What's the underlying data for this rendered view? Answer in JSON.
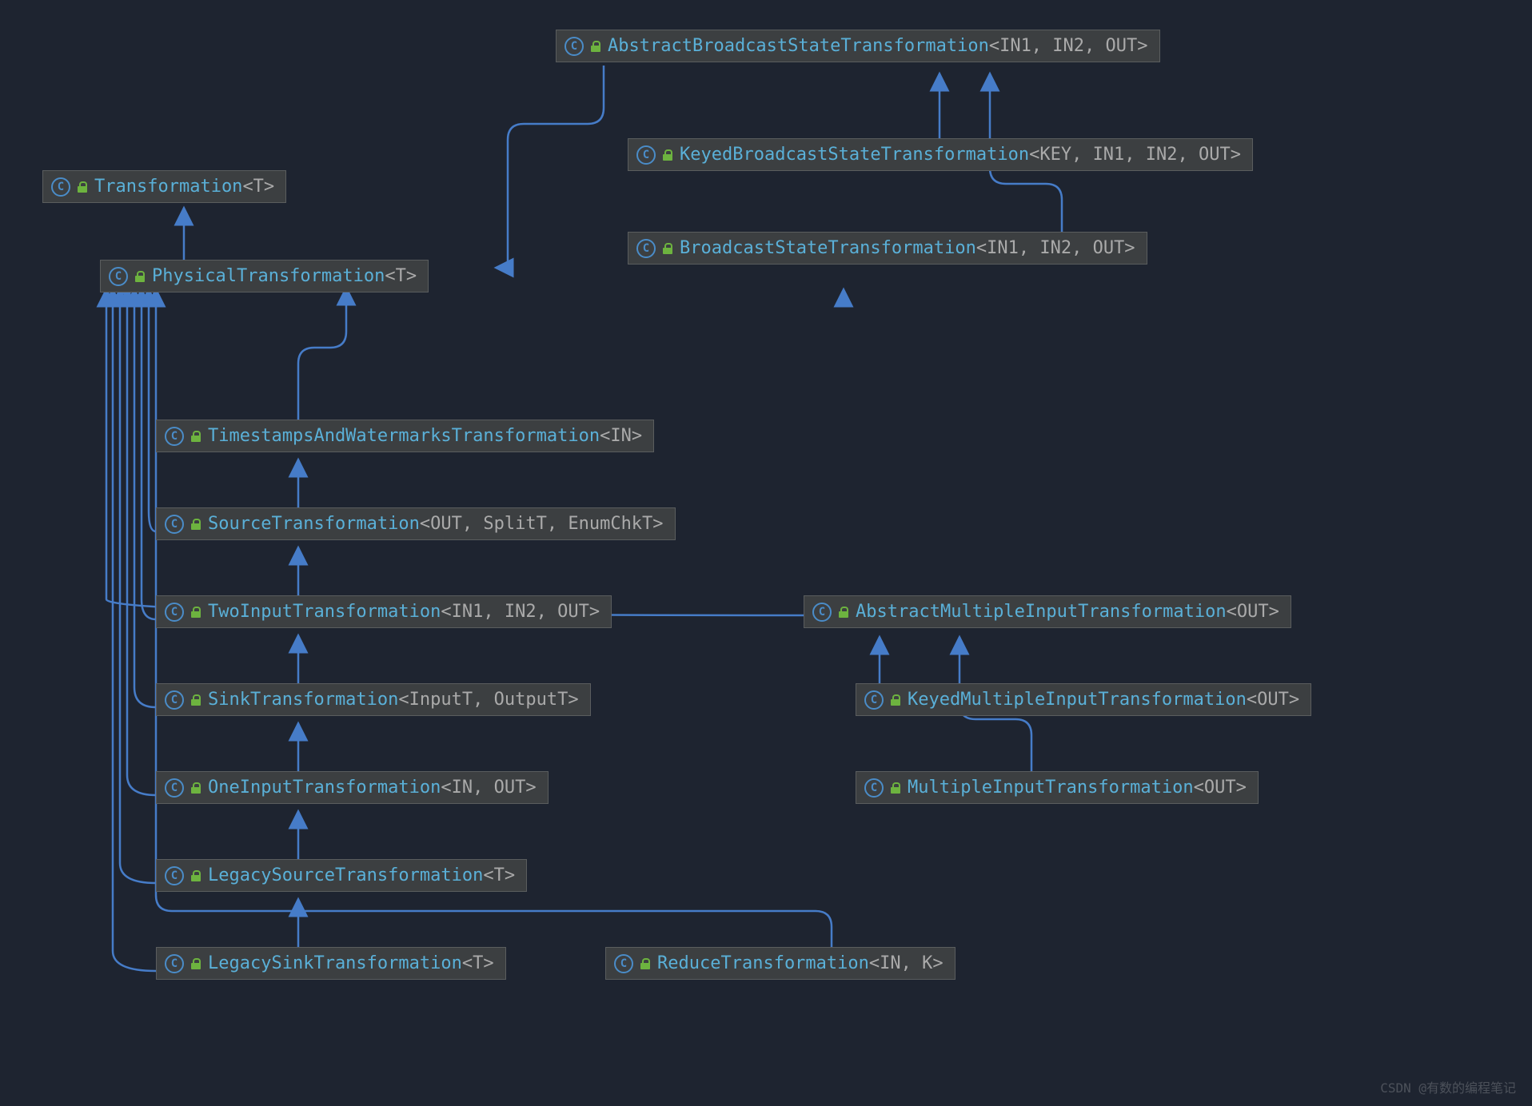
{
  "nodes": {
    "transformation": {
      "name": "Transformation",
      "gen": "<T>"
    },
    "physical": {
      "name": "PhysicalTransformation",
      "gen": "<T>"
    },
    "abstractBroadcast": {
      "name": "AbstractBroadcastStateTransformation",
      "gen": "<IN1, IN2, OUT>"
    },
    "keyedBroadcast": {
      "name": "KeyedBroadcastStateTransformation",
      "gen": "<KEY, IN1, IN2, OUT>"
    },
    "broadcast": {
      "name": "BroadcastStateTransformation",
      "gen": "<IN1, IN2, OUT>"
    },
    "timestamps": {
      "name": "TimestampsAndWatermarksTransformation",
      "gen": "<IN>"
    },
    "source": {
      "name": "SourceTransformation",
      "gen": "<OUT, SplitT, EnumChkT>"
    },
    "twoInput": {
      "name": "TwoInputTransformation",
      "gen": "<IN1, IN2, OUT>"
    },
    "sink": {
      "name": "SinkTransformation",
      "gen": "<InputT, OutputT>"
    },
    "oneInput": {
      "name": "OneInputTransformation",
      "gen": "<IN, OUT>"
    },
    "legacySource": {
      "name": "LegacySourceTransformation",
      "gen": "<T>"
    },
    "legacySink": {
      "name": "LegacySinkTransformation",
      "gen": "<T>"
    },
    "reduce": {
      "name": "ReduceTransformation",
      "gen": "<IN, K>"
    },
    "abstractMulti": {
      "name": "AbstractMultipleInputTransformation",
      "gen": "<OUT>"
    },
    "keyedMulti": {
      "name": "KeyedMultipleInputTransformation",
      "gen": "<OUT>"
    },
    "multi": {
      "name": "MultipleInputTransformation",
      "gen": "<OUT>"
    }
  },
  "watermark": "CSDN @有数的编程笔记"
}
